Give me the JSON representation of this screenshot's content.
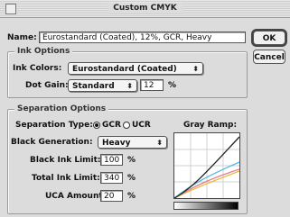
{
  "window": {
    "title": "Custom CMYK"
  },
  "name": {
    "label": "Name:",
    "value": "Eurostandard (Coated), 12%, GCR, Heavy"
  },
  "buttons": {
    "ok": "OK",
    "cancel": "Cancel"
  },
  "ink_options": {
    "title": "Ink Options",
    "ink_colors_label": "Ink Colors:",
    "ink_colors_value": "Eurostandard (Coated)",
    "dot_gain_label": "Dot Gain:",
    "dot_gain_mode": "Standard",
    "dot_gain_value": "12",
    "dot_gain_unit": "%"
  },
  "separation_options": {
    "title": "Separation Options",
    "separation_type_label": "Separation Type:",
    "gcr_label": "GCR",
    "ucr_label": "UCR",
    "selected": "GCR",
    "black_generation_label": "Black Generation:",
    "black_generation_value": "Heavy",
    "black_ink_limit_label": "Black Ink Limit:",
    "black_ink_limit_value": "100",
    "total_ink_limit_label": "Total Ink Limit:",
    "total_ink_limit_value": "340",
    "uca_amount_label": "UCA Amount:",
    "uca_amount_value": "20",
    "percent_unit": "%",
    "gray_ramp_label": "Gray Ramp:"
  },
  "colors": {
    "cyan_curve": "#5bb8e0",
    "magenta_curve": "#e87a8a",
    "yellow_curve": "#e0c040",
    "black_curve": "#222222"
  }
}
